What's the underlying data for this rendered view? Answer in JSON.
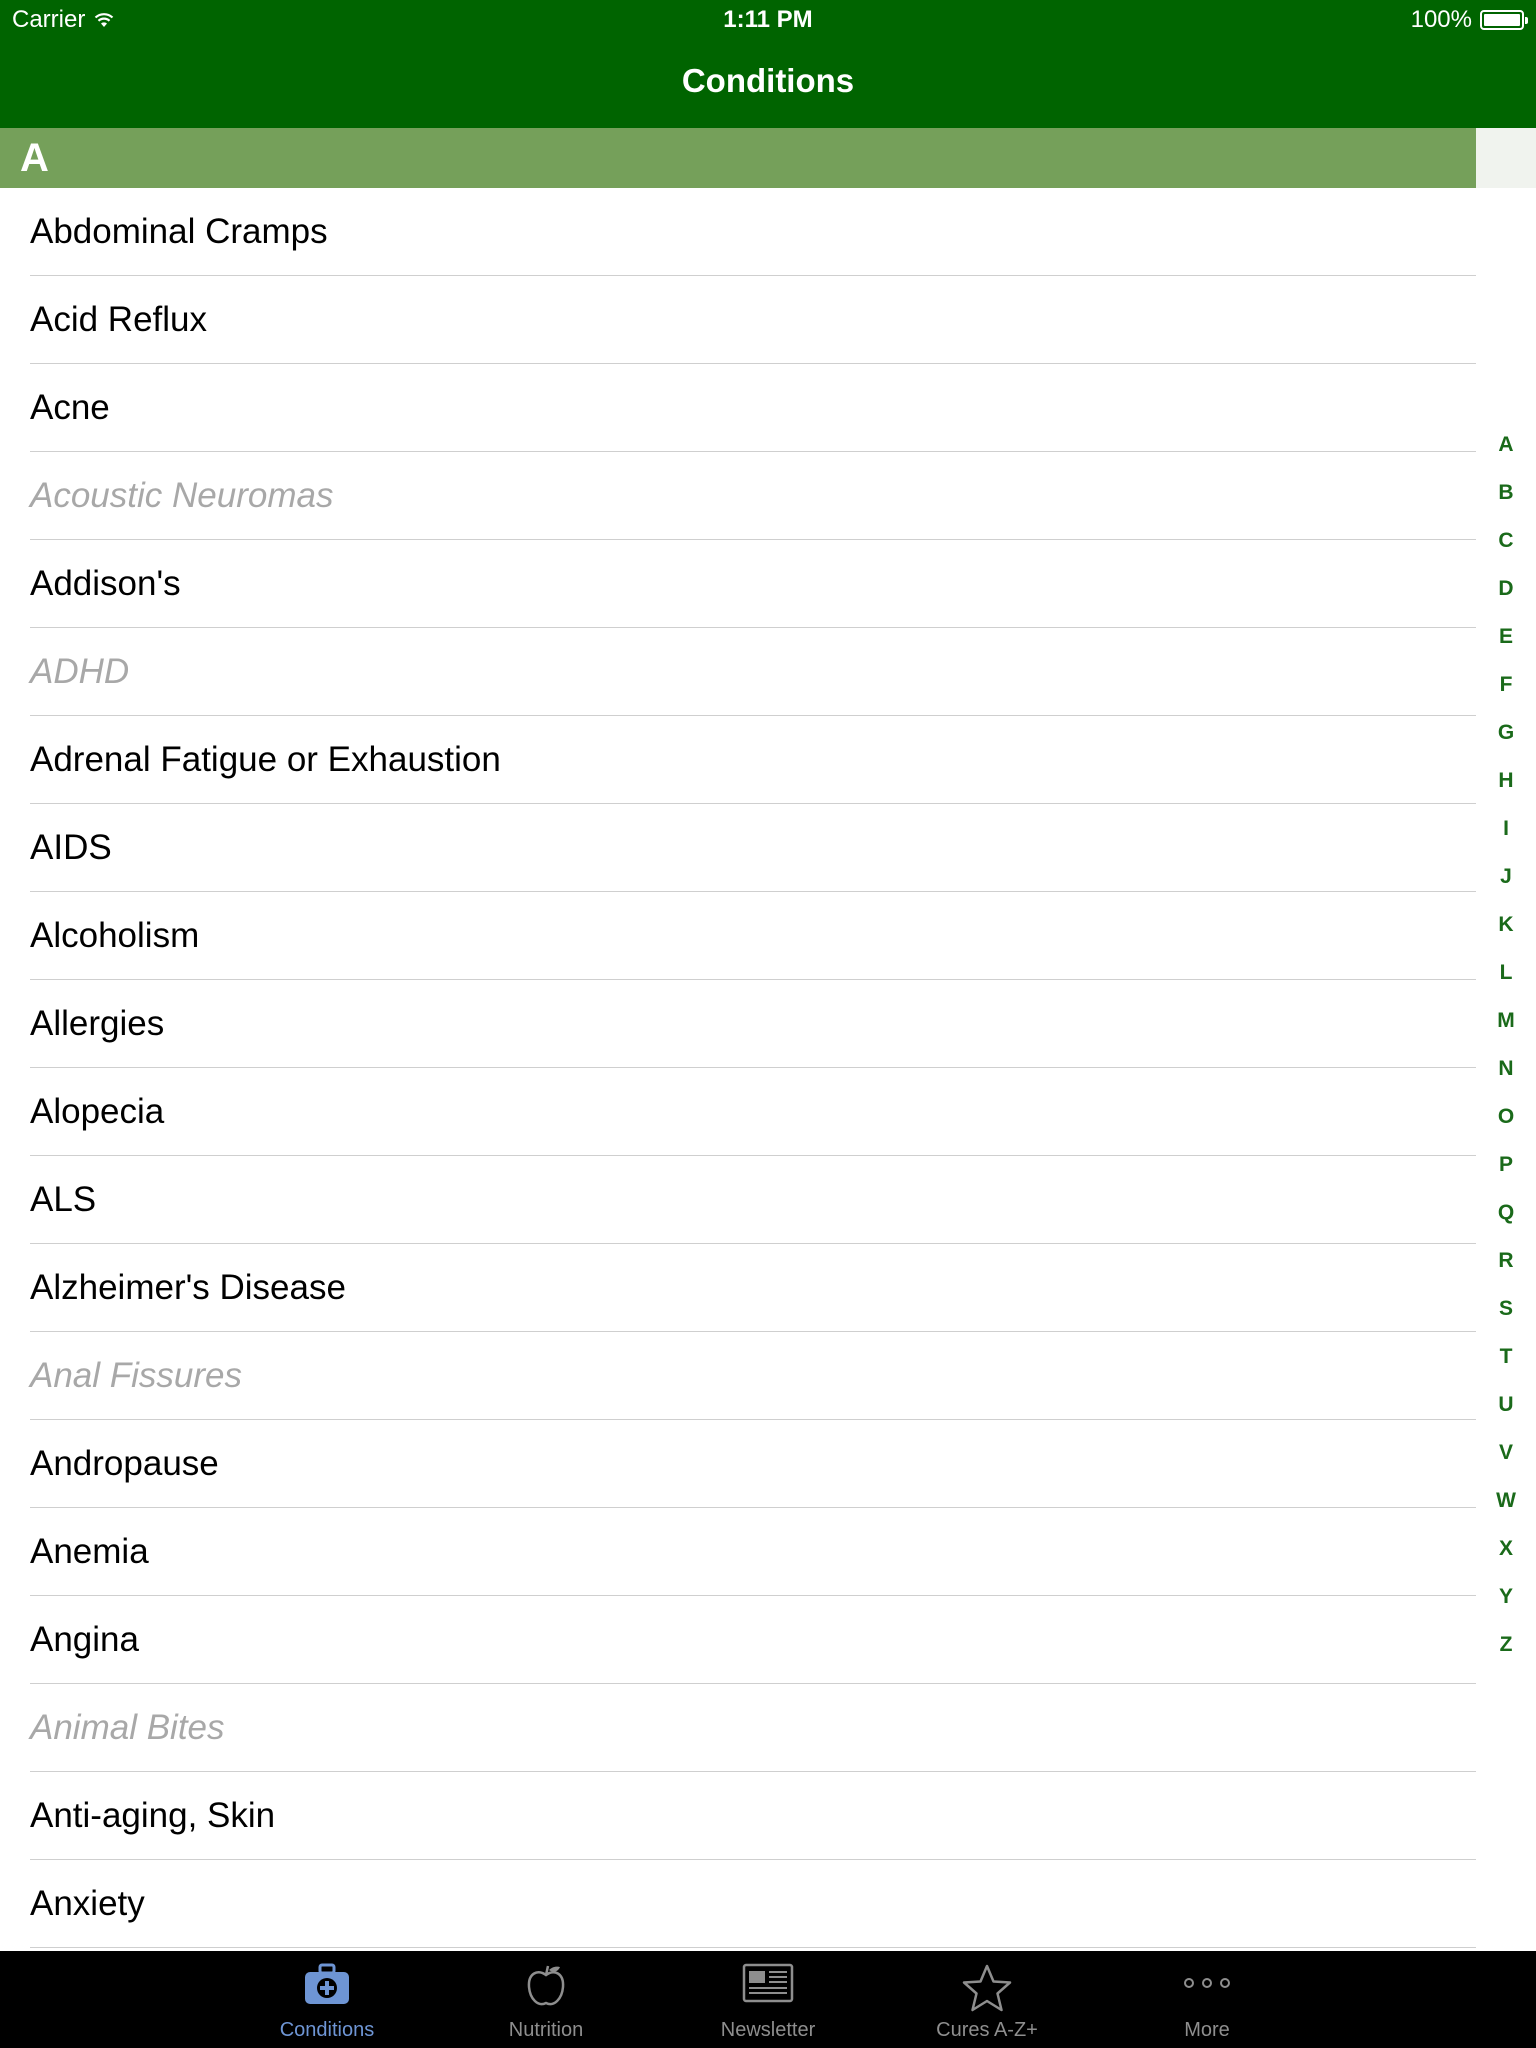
{
  "status_bar": {
    "carrier": "Carrier",
    "time": "1:11 PM",
    "battery": "100%"
  },
  "nav": {
    "title": "Conditions"
  },
  "section": {
    "header": "A"
  },
  "conditions": [
    {
      "label": "Abdominal Cramps",
      "enabled": true
    },
    {
      "label": "Acid Reflux",
      "enabled": true
    },
    {
      "label": "Acne",
      "enabled": true
    },
    {
      "label": "Acoustic Neuromas",
      "enabled": false
    },
    {
      "label": "Addison's",
      "enabled": true
    },
    {
      "label": "ADHD",
      "enabled": false
    },
    {
      "label": "Adrenal Fatigue or Exhaustion",
      "enabled": true
    },
    {
      "label": "AIDS",
      "enabled": true
    },
    {
      "label": "Alcoholism",
      "enabled": true
    },
    {
      "label": "Allergies",
      "enabled": true
    },
    {
      "label": "Alopecia",
      "enabled": true
    },
    {
      "label": "ALS",
      "enabled": true
    },
    {
      "label": "Alzheimer's Disease",
      "enabled": true
    },
    {
      "label": "Anal Fissures",
      "enabled": false
    },
    {
      "label": "Andropause",
      "enabled": true
    },
    {
      "label": "Anemia",
      "enabled": true
    },
    {
      "label": "Angina",
      "enabled": true
    },
    {
      "label": "Animal Bites",
      "enabled": false
    },
    {
      "label": "Anti-aging, Skin",
      "enabled": true
    },
    {
      "label": "Anxiety",
      "enabled": true
    }
  ],
  "index_letters": [
    "A",
    "B",
    "C",
    "D",
    "E",
    "F",
    "G",
    "H",
    "I",
    "J",
    "K",
    "L",
    "M",
    "N",
    "O",
    "P",
    "Q",
    "R",
    "S",
    "T",
    "U",
    "V",
    "W",
    "X",
    "Y",
    "Z"
  ],
  "tabs": [
    {
      "label": "Conditions",
      "icon": "medical-kit-icon",
      "active": true
    },
    {
      "label": "Nutrition",
      "icon": "apple-icon",
      "active": false
    },
    {
      "label": "Newsletter",
      "icon": "newspaper-icon",
      "active": false
    },
    {
      "label": "Cures A-Z+",
      "icon": "star-icon",
      "active": false
    },
    {
      "label": "More",
      "icon": "more-dots-icon",
      "active": false
    }
  ],
  "colors": {
    "nav_bar": "#006400",
    "section_header": "#75a05a",
    "index_letters": "#1a6a1a",
    "active_tab": "#6e95d4",
    "inactive_tab": "#8e8e8e",
    "disabled_text": "#a8a8a8"
  }
}
